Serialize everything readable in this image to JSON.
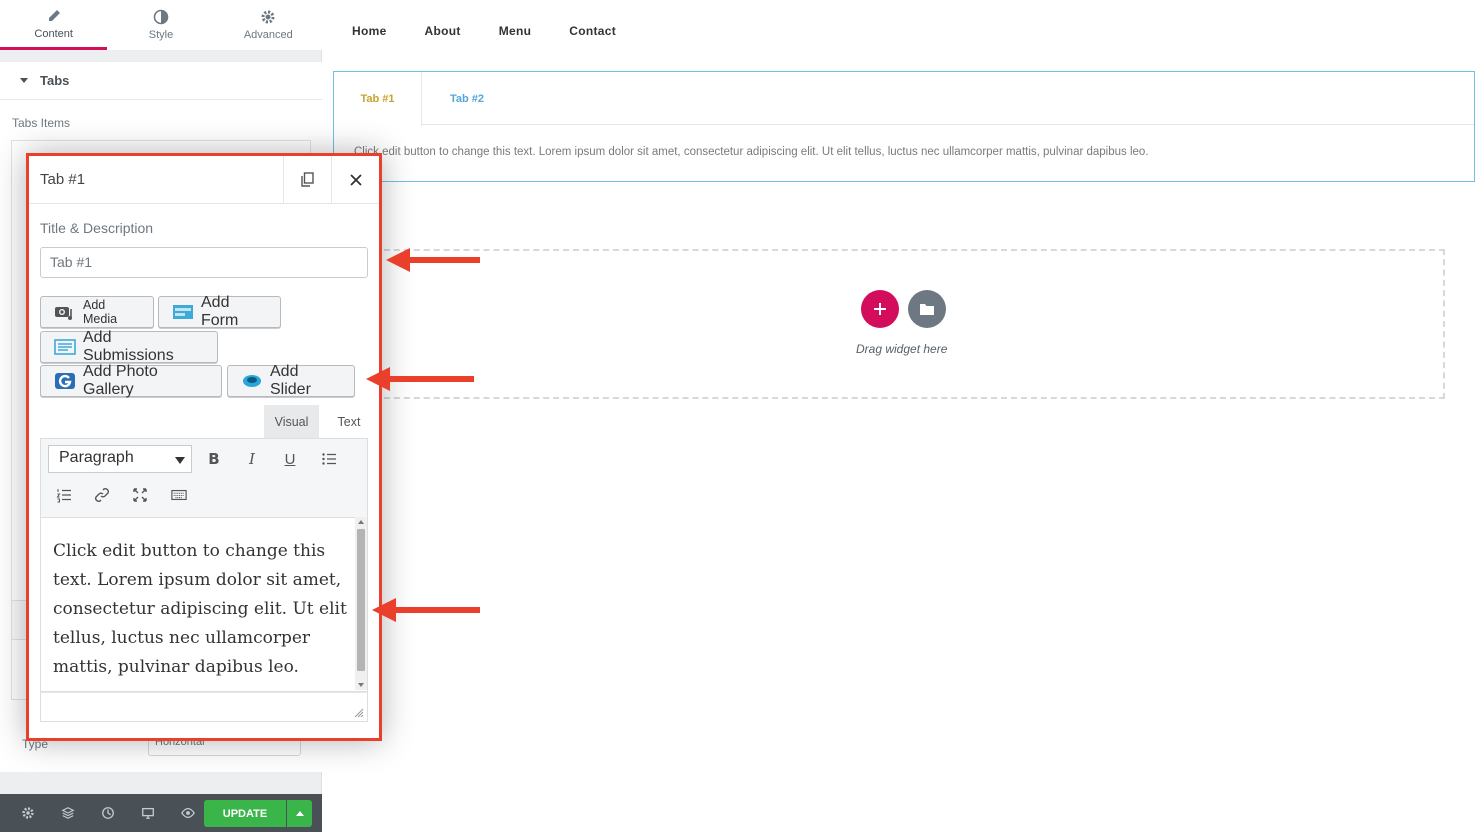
{
  "panel": {
    "tabs": [
      {
        "label": "Content",
        "icon": "pencil-icon"
      },
      {
        "label": "Style",
        "icon": "contrast-icon"
      },
      {
        "label": "Advanced",
        "icon": "gear-icon"
      }
    ],
    "section_title": "Tabs",
    "items_label": "Tabs Items",
    "type_label": "Type",
    "type_value": "Horizontal",
    "footer": {
      "update_label": "UPDATE"
    }
  },
  "nav": [
    "Home",
    "About",
    "Menu",
    "Contact"
  ],
  "canvas": {
    "tabs": [
      "Tab #1",
      "Tab #2"
    ],
    "tab_content": "Click edit button to change this text. Lorem ipsum dolor sit amet, consectetur adipiscing elit. Ut elit tellus, luctus nec ullamcorper mattis, pulvinar dapibus leo.",
    "drop_text": "Drag widget here"
  },
  "modal": {
    "title": "Tab #1",
    "field_label": "Title & Description",
    "title_value": "Tab #1",
    "buttons": {
      "add_media": "Add Media",
      "add_form": "Add Form",
      "add_submissions": "Add Submissions",
      "add_photo_gallery": "Add Photo Gallery",
      "add_slider": "Add Slider"
    },
    "editor_tabs": {
      "visual": "Visual",
      "text": "Text"
    },
    "format": "Paragraph",
    "content": "Click edit button to change this text. Lorem ipsum dolor sit amet, consectetur adipiscing elit. Ut elit tellus, luctus nec ullamcorper mattis, pulvinar dapibus leo."
  },
  "colors": {
    "accent": "#d30c5c",
    "highlight": "#ea3f2a",
    "update": "#39b54a",
    "active_tab": "#c6a42c",
    "tab_link": "#54a6d8"
  }
}
